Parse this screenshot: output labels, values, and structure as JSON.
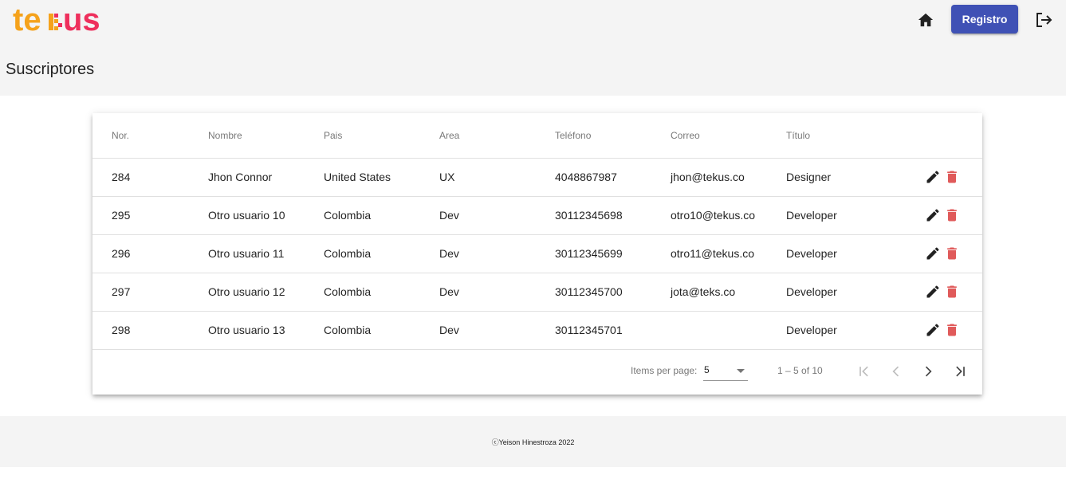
{
  "app": {
    "logo_text": "tekus",
    "register_label": "Registro"
  },
  "page": {
    "title": "Suscriptores"
  },
  "table": {
    "headers": [
      "Nor.",
      "Nombre",
      "Pais",
      "Area",
      "Teléfono",
      "Correo",
      "Título"
    ],
    "rows": [
      [
        "284",
        "Jhon Connor",
        "United States",
        "UX",
        "4048867987",
        "jhon@tekus.co",
        "Designer"
      ],
      [
        "295",
        "Otro usuario 10",
        "Colombia",
        "Dev",
        "30112345698",
        "otro10@tekus.co",
        "Developer"
      ],
      [
        "296",
        "Otro usuario 11",
        "Colombia",
        "Dev",
        "30112345699",
        "otro11@tekus.co",
        "Developer"
      ],
      [
        "297",
        "Otro usuario 12",
        "Colombia",
        "Dev",
        "30112345700",
        "jota@teks.co",
        "Developer"
      ],
      [
        "298",
        "Otro usuario 13",
        "Colombia",
        "Dev",
        "30112345701",
        "",
        "Developer"
      ]
    ]
  },
  "paginator": {
    "items_per_page_label": "Items per page:",
    "items_per_page_value": "5",
    "range_label": "1 – 5 of 10"
  },
  "footer": {
    "text": "ⓒYeison Hinestroza 2022"
  },
  "colors": {
    "primary": "#3f51b5",
    "delete": "#e05a5a",
    "logo_orange": "#f5a21b",
    "logo_pink": "#ee2f5c"
  }
}
